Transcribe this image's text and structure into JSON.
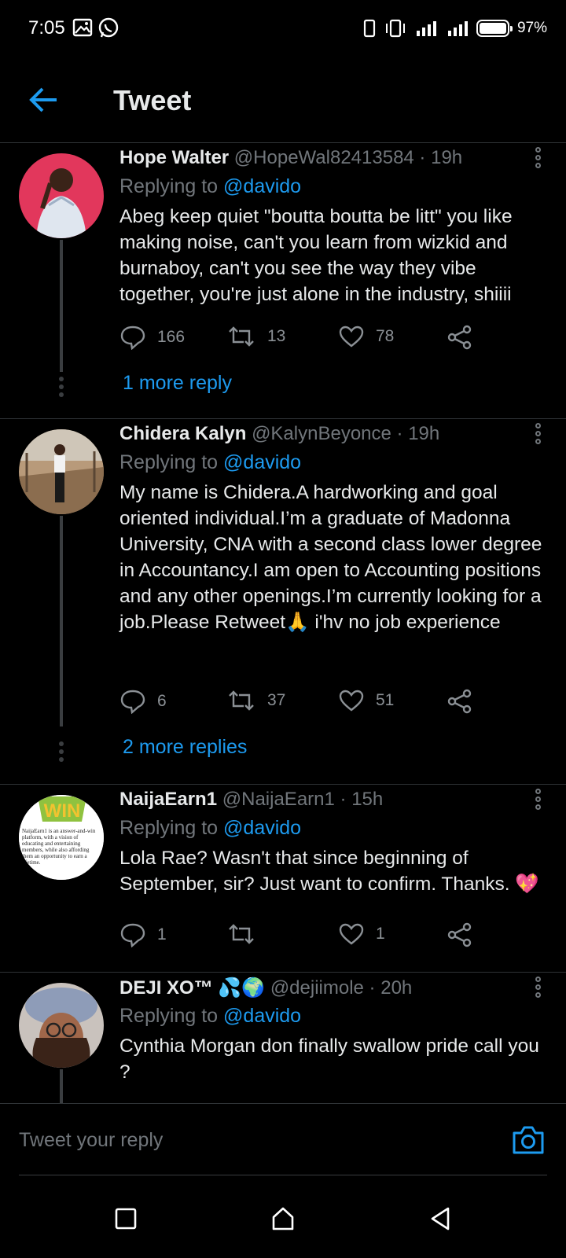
{
  "status_bar": {
    "time": "7:05",
    "battery": "97%"
  },
  "header": {
    "title": "Tweet"
  },
  "colors": {
    "accent": "#1d9bf0",
    "background": "#000000",
    "muted": "#71767b"
  },
  "tweets": [
    {
      "display_name": "Hope Walter",
      "handle": "@HopeWal82413584",
      "time": " · 19h",
      "replying_prefix": "Replying to ",
      "replying_to": "@davido",
      "text": "Abeg keep quiet \"boutta boutta be litt\" you like making noise, can't you learn from wizkid and burnaboy, can't you see the way they vibe together, you're just alone in the industry, shiiii",
      "replies": "166",
      "retweets": "13",
      "likes": "78",
      "more_replies": "1 more reply"
    },
    {
      "display_name": "Chidera Kalyn",
      "handle": "@KalynBeyonce",
      "time": " · 19h",
      "replying_prefix": "Replying to ",
      "replying_to": "@davido",
      "text": "My name is Chidera.A hardworking and goal oriented individual.I’m a graduate of Madonna University, CNA with a second class lower degree in Accountancy.I am open to Accounting positions and any other openings.I’m currently looking for a job.Please Retweet🙏 i'hv no job experience",
      "replies": "6",
      "retweets": "37",
      "likes": "51",
      "more_replies": "2 more replies"
    },
    {
      "display_name": "NaijaEarn1",
      "handle": "@NaijaEarn1",
      "time": " · 15h",
      "replying_prefix": "Replying to ",
      "replying_to": "@davido",
      "text": "Lola Rae? Wasn't that since beginning of September, sir? Just want to confirm. Thanks. 💖",
      "replies": "1",
      "retweets": "",
      "likes": "1",
      "avatar_text": "NaijaEarn1 is an answer-and-win platform, with a vision of educating and entertaining members, while also affording them an opportunity to earn a lifetime."
    },
    {
      "display_name": "DEJI XO™ 💦🌍",
      "handle": "@dejiimole",
      "time": " · 20h",
      "replying_prefix": "Replying to ",
      "replying_to": "@davido",
      "text": "Cynthia Morgan don finally swallow pride call you ?"
    }
  ],
  "reply_bar": {
    "placeholder": "Tweet your reply"
  }
}
